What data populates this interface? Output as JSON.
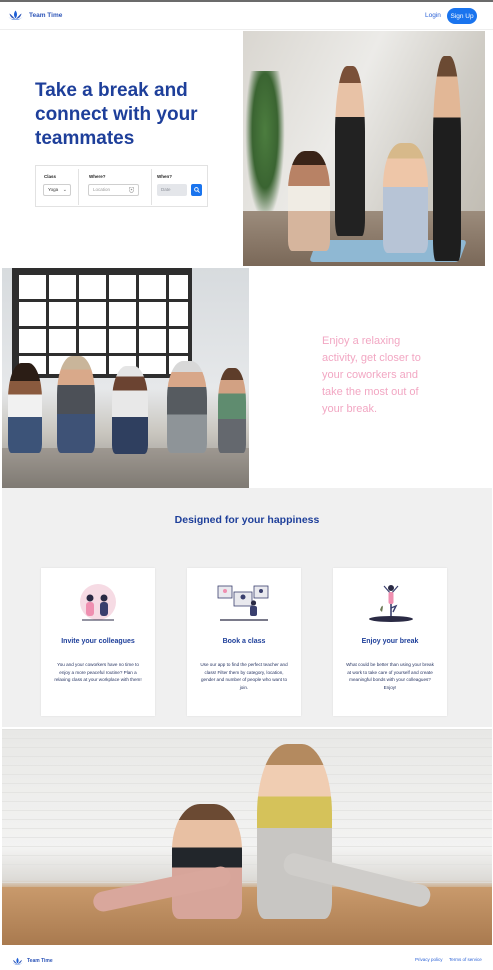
{
  "brand": {
    "name": "Team Time",
    "accent": "#1a74ee",
    "primary_text": "#1e3f9a",
    "tagline_color": "#f2a7c3"
  },
  "nav": {
    "login_label": "Login",
    "signup_label": "Sign Up",
    "logo_icon": "lotus-icon"
  },
  "hero": {
    "title": "Take a break and connect with your teammates",
    "search": {
      "class_label": "Class",
      "class_value": "Yoga",
      "where_label": "Where?",
      "where_placeholder": "Location",
      "when_label": "When?",
      "when_placeholder": "Date",
      "icons": [
        "chevron-down-icon",
        "location-pin-icon",
        "search-icon"
      ]
    }
  },
  "tagline": {
    "text": "Enjoy a relaxing activity, get closer to your coworkers and take the most out of your break."
  },
  "features": {
    "title": "Designed for your happiness",
    "cards": [
      {
        "title": "Invite your colleagues",
        "text": "You and your coworkers have no time to enjoy a more peaceful routine? Plan a relaxing class at your workplace with them!"
      },
      {
        "title": "Book a class",
        "text": "Use our app to find the perfect teacher and class! Filter them by category, location, gender and number of people who want to join."
      },
      {
        "title": "Enjoy your break",
        "text": "What could be better than using your break at work to take care of yourself and create meaningful bonds with your colleagues? Enjoy!"
      }
    ]
  },
  "footer": {
    "brand": "Team Time",
    "privacy_label": "Privacy policy",
    "terms_label": "Terms of service"
  }
}
